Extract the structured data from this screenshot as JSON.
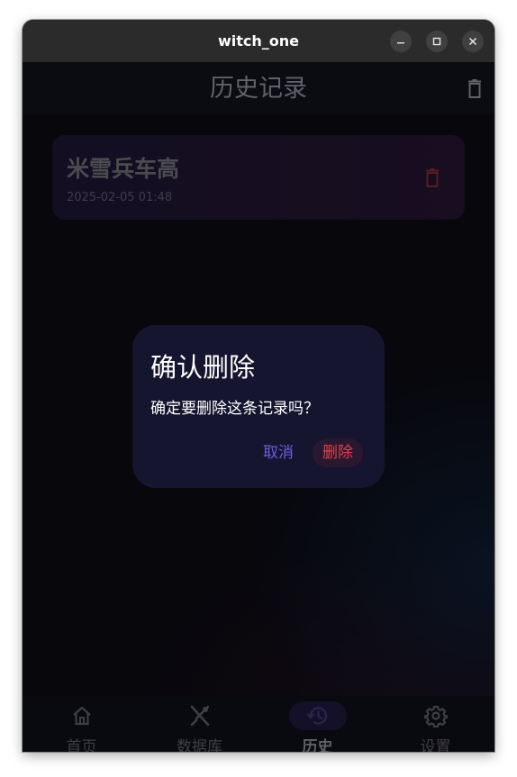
{
  "window": {
    "title": "witch_one"
  },
  "appbar": {
    "title": "历史记录",
    "clear_icon": "delete-icon"
  },
  "history": [
    {
      "name": "米雪兵车高",
      "time": "2025-02-05 01:48",
      "delete_icon": "delete-icon"
    }
  ],
  "dialog": {
    "title": "确认删除",
    "message": "确定要删除这条记录吗？",
    "cancel_label": "取消",
    "confirm_label": "删除"
  },
  "nav": [
    {
      "label": "首页",
      "icon": "home-icon",
      "active": false
    },
    {
      "label": "数据库",
      "icon": "utensils-icon",
      "active": false
    },
    {
      "label": "历史",
      "icon": "history-icon",
      "active": true
    },
    {
      "label": "设置",
      "icon": "gear-icon",
      "active": false
    }
  ],
  "colors": {
    "accent": "#6d5ce0",
    "danger": "#e0424a",
    "dialog_bg": "#161530"
  }
}
